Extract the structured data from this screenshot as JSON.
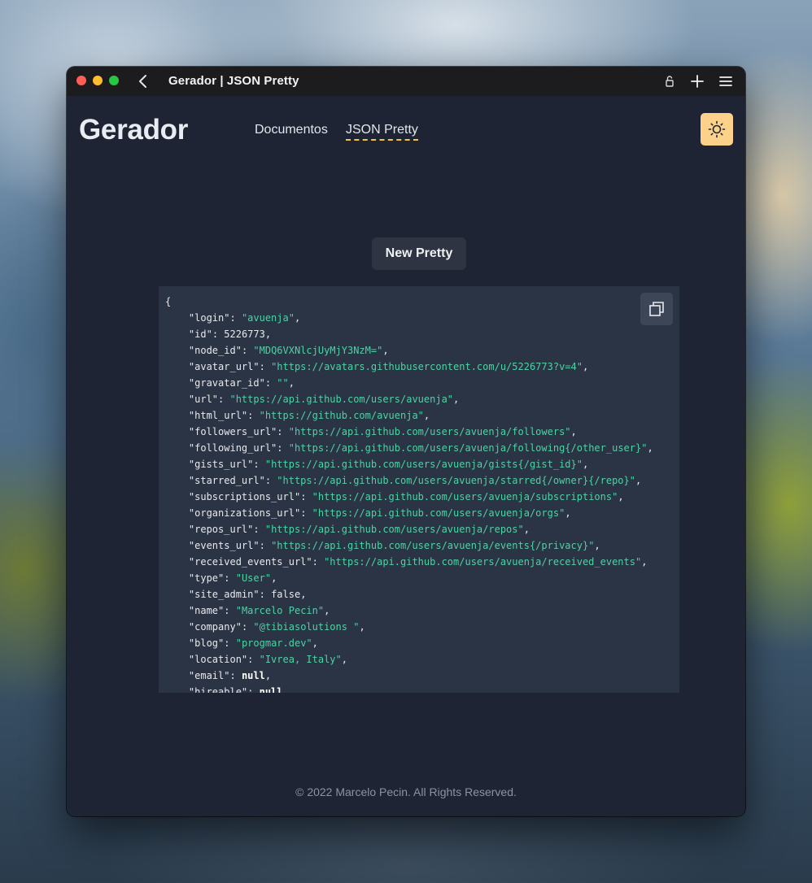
{
  "window": {
    "title": "Gerador | JSON Pretty"
  },
  "header": {
    "logo": "Gerador",
    "nav": [
      {
        "label": "Documentos",
        "active": false
      },
      {
        "label": "JSON Pretty",
        "active": true
      }
    ],
    "theme_icon": "sun-icon"
  },
  "main": {
    "new_button_label": "New Pretty",
    "copy_icon": "copy-icon",
    "json_lines": [
      {
        "key": "login",
        "type": "string",
        "value": "avuenja"
      },
      {
        "key": "id",
        "type": "number",
        "value": "5226773"
      },
      {
        "key": "node_id",
        "type": "string",
        "value": "MDQ6VXNlcjUyMjY3NzM="
      },
      {
        "key": "avatar_url",
        "type": "string",
        "value": "https://avatars.githubusercontent.com/u/5226773?v=4"
      },
      {
        "key": "gravatar_id",
        "type": "string",
        "value": ""
      },
      {
        "key": "url",
        "type": "string",
        "value": "https://api.github.com/users/avuenja"
      },
      {
        "key": "html_url",
        "type": "string",
        "value": "https://github.com/avuenja"
      },
      {
        "key": "followers_url",
        "type": "string",
        "value": "https://api.github.com/users/avuenja/followers"
      },
      {
        "key": "following_url",
        "type": "string",
        "value": "https://api.github.com/users/avuenja/following{/other_user}"
      },
      {
        "key": "gists_url",
        "type": "string",
        "value": "https://api.github.com/users/avuenja/gists{/gist_id}"
      },
      {
        "key": "starred_url",
        "type": "string",
        "value": "https://api.github.com/users/avuenja/starred{/owner}{/repo}"
      },
      {
        "key": "subscriptions_url",
        "type": "string",
        "value": "https://api.github.com/users/avuenja/subscriptions"
      },
      {
        "key": "organizations_url",
        "type": "string",
        "value": "https://api.github.com/users/avuenja/orgs"
      },
      {
        "key": "repos_url",
        "type": "string",
        "value": "https://api.github.com/users/avuenja/repos"
      },
      {
        "key": "events_url",
        "type": "string",
        "value": "https://api.github.com/users/avuenja/events{/privacy}"
      },
      {
        "key": "received_events_url",
        "type": "string",
        "value": "https://api.github.com/users/avuenja/received_events"
      },
      {
        "key": "type",
        "type": "string",
        "value": "User"
      },
      {
        "key": "site_admin",
        "type": "bool",
        "value": "false"
      },
      {
        "key": "name",
        "type": "string",
        "value": "Marcelo Pecin"
      },
      {
        "key": "company",
        "type": "string",
        "value": "@tibiasolutions "
      },
      {
        "key": "blog",
        "type": "string",
        "value": "progmar.dev"
      },
      {
        "key": "location",
        "type": "string",
        "value": "Ivrea, Italy"
      },
      {
        "key": "email",
        "type": "null",
        "value": "null"
      },
      {
        "key": "hireable",
        "type": "null",
        "value": "null"
      }
    ]
  },
  "footer": {
    "text": "© 2022 Marcelo Pecin. All Rights Reserved."
  },
  "colors": {
    "accent": "#fcd28a",
    "underline": "#f4c542",
    "string": "#4fd1a5",
    "page_bg": "#1e2433",
    "code_bg": "#2b3445"
  }
}
